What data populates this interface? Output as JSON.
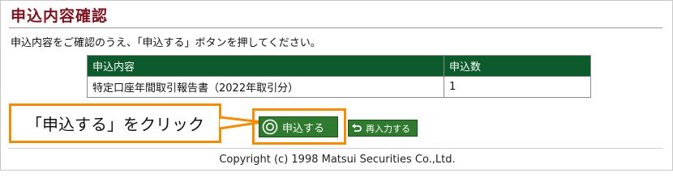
{
  "page": {
    "title": "申込内容確認",
    "instruction": "申込内容をご確認のうえ、「申込する」ボタンを押してください。",
    "copyright": "Copyright (c) 1998 Matsui Securities Co.,Ltd."
  },
  "table": {
    "headers": [
      "申込内容",
      "申込数"
    ],
    "rows": [
      [
        "特定口座年間取引報告書（2022年取引分）",
        "1"
      ]
    ]
  },
  "buttons": {
    "apply_label": "申込する",
    "reenter_label": "再入力する"
  },
  "annotation": {
    "text": "「申込する」をクリック",
    "color": "#f08c00"
  },
  "colors": {
    "title": "#7a1420",
    "table_header": "#0d5a2c",
    "button": "#2f7a2f"
  },
  "icons": {
    "apply": "target-circle-icon",
    "reenter": "undo-arrow-icon"
  }
}
